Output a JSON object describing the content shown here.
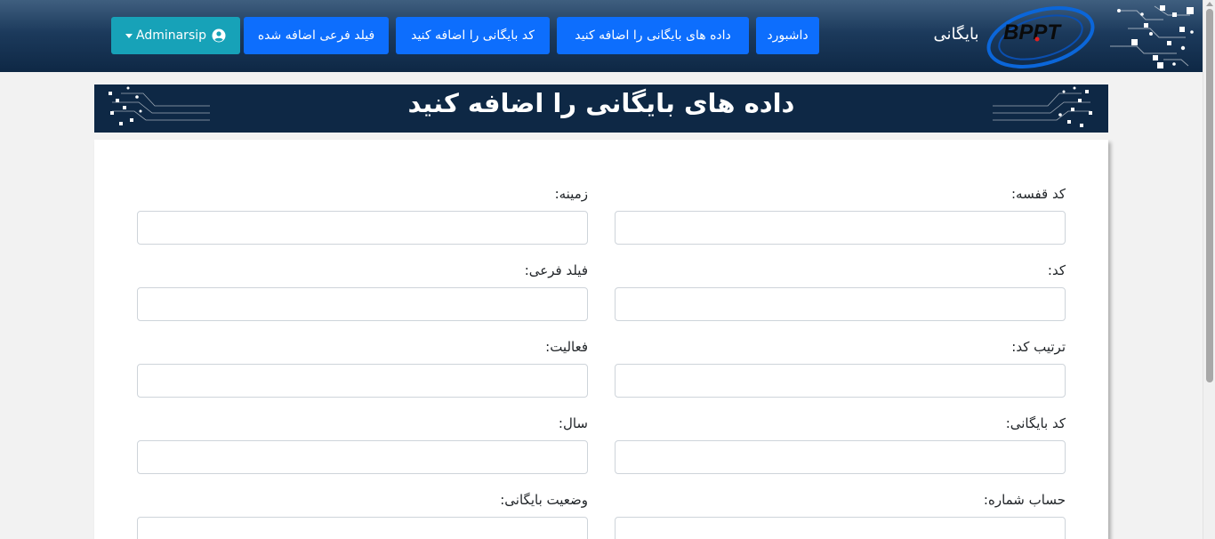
{
  "header": {
    "logo_text": "BPPT",
    "app_title": "بایگانی",
    "nav": [
      {
        "label": "داشبورد"
      },
      {
        "label": "داده های بایگانی را اضافه کنید"
      },
      {
        "label": "کد بایگانی را اضافه کنید"
      },
      {
        "label": "فیلد فرعی اضافه شده"
      }
    ],
    "user_menu": {
      "label": "Adminarsip",
      "icon": "user-circle-icon",
      "dropdown_icon": "caret-down-icon"
    }
  },
  "page": {
    "title": "داده های بایگانی را اضافه کنید"
  },
  "form": {
    "fields": [
      {
        "label": "کد قفسه:",
        "value": "",
        "placeholder": ""
      },
      {
        "label": "زمینه:",
        "value": "",
        "placeholder": ""
      },
      {
        "label": "کد:",
        "value": "",
        "placeholder": ""
      },
      {
        "label": "فیلد فرعی:",
        "value": "",
        "placeholder": ""
      },
      {
        "label": "ترتیب کد:",
        "value": "",
        "placeholder": ""
      },
      {
        "label": "فعالیت:",
        "value": "",
        "placeholder": ""
      },
      {
        "label": "کد بایگانی:",
        "value": "",
        "placeholder": ""
      },
      {
        "label": "سال:",
        "value": "",
        "placeholder": ""
      },
      {
        "label": "حساب شماره:",
        "value": "",
        "placeholder": ""
      },
      {
        "label": "وضعیت بایگانی:",
        "value": "",
        "placeholder": ""
      }
    ]
  },
  "colors": {
    "navbar": "#1c3a5c",
    "nav_button": "#0d6efd",
    "user_button": "#17a2b8",
    "banner": "#0e2845"
  }
}
